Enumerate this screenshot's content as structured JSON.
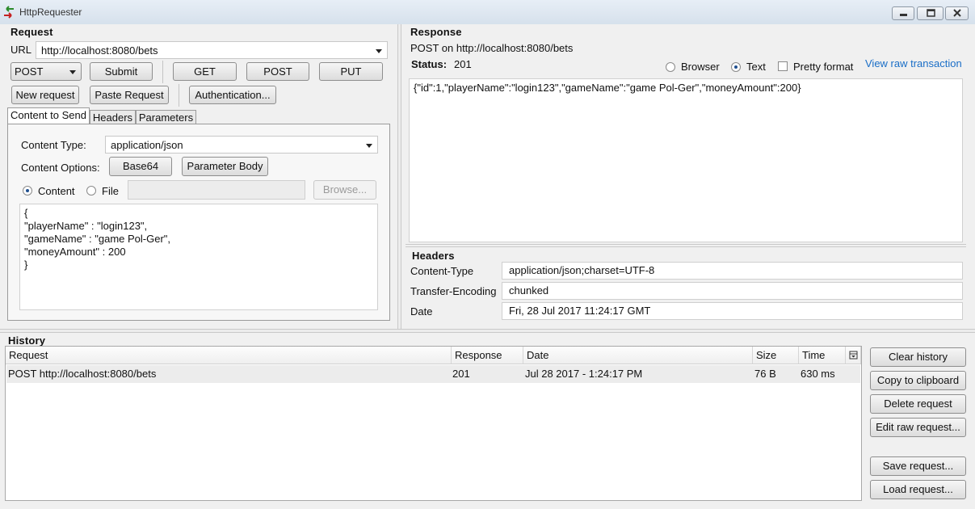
{
  "window": {
    "title": "HttpRequester"
  },
  "request": {
    "section_title": "Request",
    "url_label": "URL",
    "url_value": "http://localhost:8080/bets",
    "method_selected": "POST",
    "submit_label": "Submit",
    "get_label": "GET",
    "post_label": "POST",
    "put_label": "PUT",
    "new_request_label": "New request",
    "paste_request_label": "Paste Request",
    "authentication_label": "Authentication...",
    "tabs": [
      "Content to Send",
      "Headers",
      "Parameters"
    ],
    "content_type_label": "Content Type:",
    "content_type_value": "application/json",
    "content_options_label": "Content Options:",
    "base64_label": "Base64",
    "parameter_body_label": "Parameter Body",
    "content_radio_label": "Content",
    "file_radio_label": "File",
    "browse_label": "Browse...",
    "body_lines": [
      "{",
      "\"playerName\" : \"login123\",",
      "\"gameName\" : \"game Pol-Ger\",",
      "\"moneyAmount\" : 200",
      "}"
    ]
  },
  "response": {
    "section_title": "Response",
    "summary": "POST on http://localhost:8080/bets",
    "status_label": "Status:",
    "status_value": "201",
    "browser_label": "Browser",
    "text_label": "Text",
    "pretty_format_label": "Pretty format",
    "view_raw_label": "View raw transaction",
    "body": "{\"id\":1,\"playerName\":\"login123\",\"gameName\":\"game Pol-Ger\",\"moneyAmount\":200}",
    "headers_title": "Headers",
    "headers": [
      {
        "name": "Content-Type",
        "value": "application/json;charset=UTF-8"
      },
      {
        "name": "Transfer-Encoding",
        "value": "chunked"
      },
      {
        "name": "Date",
        "value": "Fri, 28 Jul 2017 11:24:17 GMT"
      }
    ]
  },
  "history": {
    "section_title": "History",
    "columns": [
      "Request",
      "Response",
      "Date",
      "Size",
      "Time"
    ],
    "rows": [
      {
        "request": "POST http://localhost:8080/bets",
        "response": "201",
        "date": "Jul 28 2017 - 1:24:17 PM",
        "size": "76 B",
        "time": "630 ms"
      }
    ],
    "clear_history_label": "Clear history",
    "copy_clipboard_label": "Copy to clipboard",
    "delete_request_label": "Delete request",
    "edit_raw_label": "Edit raw request...",
    "save_request_label": "Save request...",
    "load_request_label": "Load request..."
  }
}
